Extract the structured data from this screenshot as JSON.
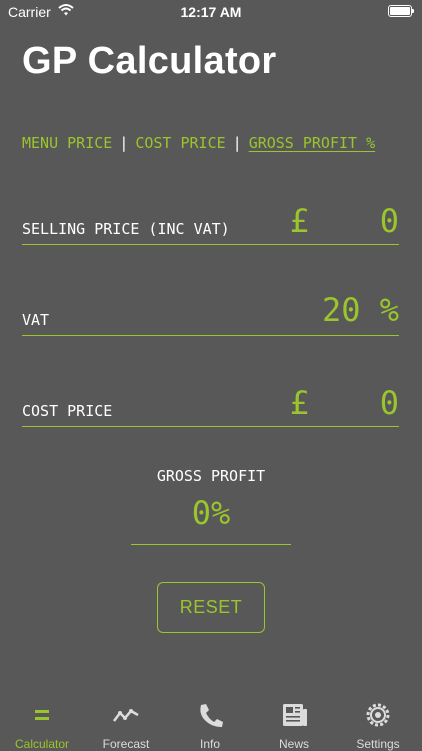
{
  "status": {
    "carrier": "Carrier",
    "time": "12:17 AM"
  },
  "title": "GP Calculator",
  "mode_tabs": {
    "menu": "MENU PRICE",
    "cost": "COST PRICE",
    "gross": "GROSS PROFIT %",
    "separator": "|"
  },
  "fields": {
    "selling": {
      "label": "SELLING PRICE (INC VAT)",
      "currency": "£",
      "value": "0"
    },
    "vat": {
      "label": "VAT",
      "value": "20",
      "unit": "%"
    },
    "cost": {
      "label": "COST PRICE",
      "currency": "£",
      "value": "0"
    }
  },
  "gross_profit": {
    "label": "GROSS PROFIT",
    "value": "0%"
  },
  "reset_label": "RESET",
  "tab_bar": {
    "items": [
      {
        "label": "Calculator",
        "icon": "equals-icon",
        "active": true
      },
      {
        "label": "Forecast",
        "icon": "chart-line-icon"
      },
      {
        "label": "Info",
        "icon": "phone-icon"
      },
      {
        "label": "News",
        "icon": "newspaper-icon"
      },
      {
        "label": "Settings",
        "icon": "gear-icon"
      }
    ]
  },
  "colors": {
    "background": "#585858",
    "accent": "#9ac52d",
    "text": "#ffffff"
  }
}
